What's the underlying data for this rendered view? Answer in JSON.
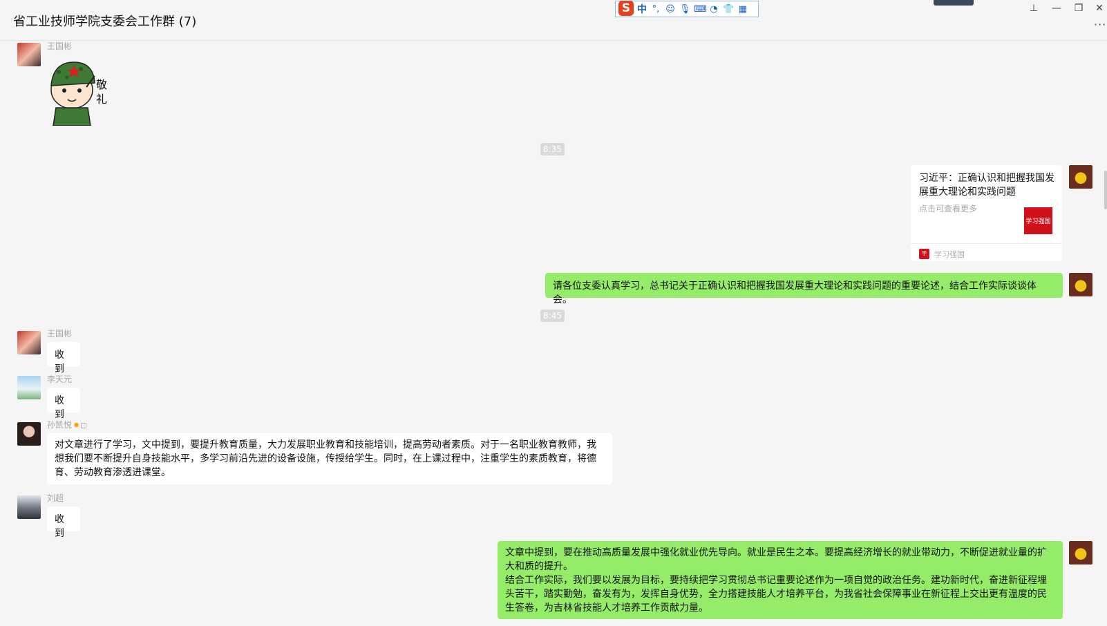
{
  "window": {
    "title": "省工业技师学院支委会工作群 (7)",
    "more_label": "···"
  },
  "ime": {
    "logo_label": "S",
    "mode_label": "中",
    "icons": [
      "punctuation-icon",
      "emoji-icon",
      "mic-icon",
      "keyboard-icon",
      "voice-input-icon",
      "skin-icon",
      "toolbox-icon"
    ]
  },
  "window_buttons": {
    "pin": "⊥",
    "minimize": "—",
    "restore": "❐",
    "close": "✕"
  },
  "messages": {
    "m1": {
      "sender": "王国彬",
      "sticker_text": "敬礼"
    },
    "t1": "8:35",
    "m2": {
      "card_title": "习近平：正确认识和把握我国发展重大理论和实践问题",
      "card_desc": "点击可查看更多",
      "card_thumb_text": "学习强国",
      "card_source": "学习强国"
    },
    "m3": {
      "text": "请各位支委认真学习，总书记关于正确认识和把握我国发展重大理论和实践问题的重要论述，结合工作实际谈谈体会。"
    },
    "t2": "8:45",
    "m4": {
      "sender": "王国彬",
      "text": "收到"
    },
    "m5": {
      "sender": "李天元",
      "text": "收到"
    },
    "m6": {
      "sender": "孙凯悦",
      "text": "对文章进行了学习，文中提到，要提升教育质量，大力发展职业教育和技能培训，提高劳动者素质。对于一名职业教育教师，我想我们要不断提升自身技能水平，多学习前沿先进的设备设施，传授给学生。同时，在上课过程中，注重学生的素质教育，将德育、劳动教育渗透进课堂。"
    },
    "m7": {
      "sender": "刘超",
      "text": "收到"
    },
    "m8": {
      "text_p1": "文章中提到，要在推动高质量发展中强化就业优先导向。就业是民生之本。要提高经济增长的就业带动力，不断促进就业量的扩大和质的提升。",
      "text_p2": "结合工作实际，我们要以发展为目标，要持续把学习贯彻总书记重要论述作为一项自觉的政治任务。建功新时代，奋进新征程埋头苦干，踏实勤勉，奋发有为，发挥自身优势，全力搭建技能人才培养平台，为我省社会保障事业在新征程上交出更有温度的民生答卷，为吉林省技能人才培养工作贡献力量。"
    }
  },
  "colors": {
    "self_bubble": "#95ec69",
    "other_bubble": "#ffffff",
    "background": "#f5f5f5"
  }
}
